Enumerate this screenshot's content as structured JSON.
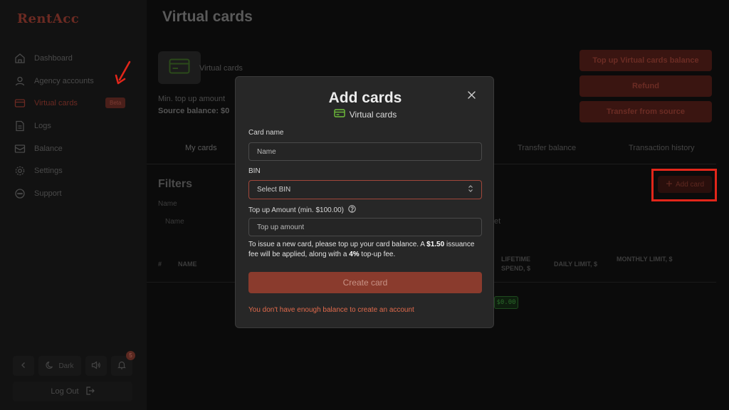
{
  "app": {
    "logo": "RentAcc"
  },
  "sidebar": {
    "items": [
      {
        "label": "Dashboard",
        "icon": "home-icon"
      },
      {
        "label": "Agency accounts",
        "icon": "user-icon"
      },
      {
        "label": "Virtual cards",
        "icon": "card-icon",
        "badge": "Beta"
      },
      {
        "label": "Logs",
        "icon": "document-icon"
      },
      {
        "label": "Balance",
        "icon": "envelope-icon"
      },
      {
        "label": "Settings",
        "icon": "gear-icon"
      },
      {
        "label": "Support",
        "icon": "chat-icon"
      }
    ],
    "theme_label": "Dark",
    "notification_count": "5",
    "logout_label": "Log Out"
  },
  "page": {
    "title": "Virtual cards",
    "card_label": "Virtual cards",
    "min_topup": "Min. top up amount",
    "source_balance": "Source balance: $0",
    "buttons": {
      "topup": "Top up Virtual cards balance",
      "refund": "Refund",
      "transfer": "Transfer from source"
    },
    "tabs": [
      "My cards",
      "Transfer balance",
      "Transaction history"
    ],
    "filters": {
      "title": "Filters",
      "name_label": "Name",
      "name_placeholder": "Name",
      "partial_text": "et"
    },
    "add_card": "Add card",
    "table": {
      "headers": {
        "num": "#",
        "name": "NAME",
        "lifetime": "LIFETIME SPEND, $",
        "daily": "DAILY LIMIT, $",
        "monthly": "MONTHLY LIMIT, $"
      },
      "row_value": "$0.00"
    }
  },
  "modal": {
    "title": "Add cards",
    "subtitle": "Virtual cards",
    "card_name_label": "Card name",
    "card_name_placeholder": "Name",
    "bin_label": "BIN",
    "bin_placeholder": "Select BIN",
    "amount_label": "Top up Amount (min. $100.00)",
    "amount_placeholder": "Top up amount",
    "info_1": "To issue a new card, please top up your card balance. A ",
    "info_fee": "$1.50",
    "info_2": " issuance fee will be applied, along with a ",
    "info_pct": "4%",
    "info_3": " top-up fee.",
    "create_button": "Create card",
    "error": "You don't have enough balance to create an account"
  },
  "colors": {
    "accent": "#8a3b2d",
    "error": "#e06a4c",
    "highlight": "#e2261a"
  }
}
